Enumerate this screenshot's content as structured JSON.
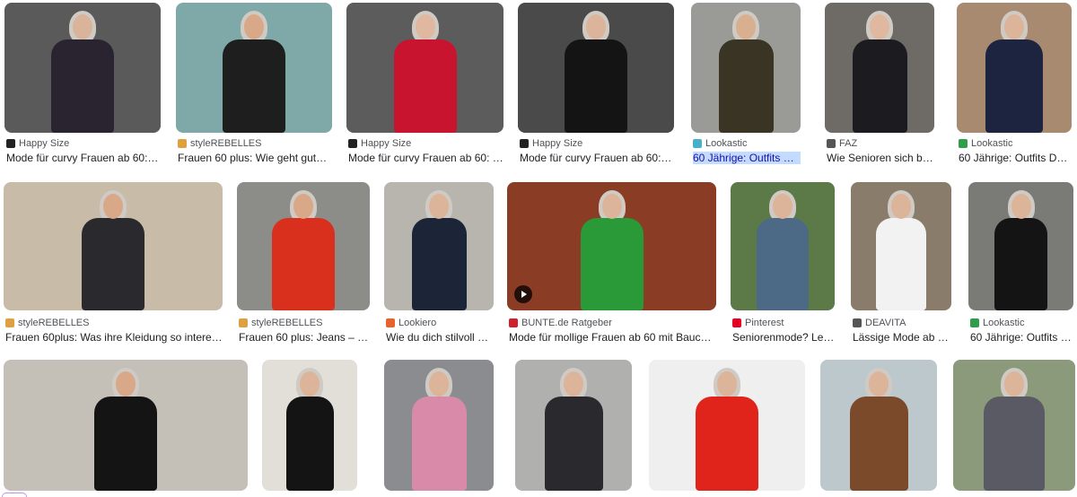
{
  "row1": [
    {
      "source": "Happy Size",
      "title": "Mode für curvy Frauen ab 60: …",
      "fav": "#222222",
      "favGlyph": "H",
      "bg": "#5a5a5a",
      "fg": "#2a2430",
      "skin": "#d9b49a"
    },
    {
      "source": "styleREBELLES",
      "title": "Frauen 60 plus: Wie geht gute…",
      "fav": "#e0a040",
      "favGlyph": "⚓",
      "bg": "#7fa8a8",
      "fg": "#1e1e1e",
      "skin": "#d8a888"
    },
    {
      "source": "Happy Size",
      "title": "Mode für curvy Frauen ab 60: …",
      "fav": "#222222",
      "favGlyph": "H",
      "bg": "#5c5c5c",
      "fg": "#c8142e",
      "skin": "#e0b8a0"
    },
    {
      "source": "Happy Size",
      "title": "Mode für curvy Frauen ab 60: …",
      "fav": "#222222",
      "favGlyph": "H",
      "bg": "#4a4a4a",
      "fg": "#141414",
      "skin": "#dcb49c"
    },
    {
      "source": "Lookastic",
      "title": "60 Jährige: Outfits Da…",
      "fav": "#46b1c9",
      "favGlyph": "L",
      "bg": "#9a9a96",
      "fg": "#3a3424",
      "skin": "#d8b090",
      "selected": true
    },
    {
      "source": "FAZ",
      "title": "Wie Senioren sich be…",
      "fav": "#555555",
      "favGlyph": "F",
      "bg": "#6e6a66",
      "fg": "#1c1c20",
      "skin": "#e0b8a0"
    },
    {
      "source": "Lookastic",
      "title": "60 Jährige: Outfits Da…",
      "fav": "#2e9e4a",
      "favGlyph": "L",
      "bg": "#a88a70",
      "fg": "#1c2440",
      "skin": "#dcb49a"
    }
  ],
  "row2": [
    {
      "source": "styleREBELLES",
      "title": "Frauen 60plus: Was ihre Kleidung so intere…",
      "fav": "#e0a040",
      "favGlyph": "⚓",
      "bg": "#c8bba8",
      "fg": "#2a2a2e",
      "skin": "#d8a888"
    },
    {
      "source": "styleREBELLES",
      "title": "Frauen 60 plus: Jeans – …",
      "fav": "#e0a040",
      "favGlyph": "⚓",
      "bg": "#8c8c88",
      "fg": "#d8301c",
      "skin": "#d8a888"
    },
    {
      "source": "Lookiero",
      "title": "Wie du dich stilvoll …",
      "fav": "#e8622c",
      "favGlyph": "lk",
      "bg": "#b8b4ae",
      "fg": "#1c2438",
      "skin": "#dcb49a"
    },
    {
      "source": "BUNTE.de Ratgeber",
      "title": "Mode für mollige Frauen ab 60 mit Bauch…",
      "fav": "#d0202c",
      "favGlyph": "B",
      "bg": "#8a3c24",
      "fg": "#2a9a38",
      "skin": "#dcb49a",
      "video": true
    },
    {
      "source": "Pinterest",
      "title": "Seniorenmode? Le…",
      "fav": "#e60023",
      "favGlyph": "P",
      "bg": "#5c7a48",
      "fg": "#4c6a86",
      "skin": "#dcb49a"
    },
    {
      "source": "DEAVITA",
      "title": "Lässige Mode ab 6…",
      "fav": "#555555",
      "favGlyph": "D",
      "bg": "#8a7c6a",
      "fg": "#f2f2f2",
      "skin": "#dcb49a"
    },
    {
      "source": "Lookastic",
      "title": "60 Jährige: Outfits …",
      "fav": "#2e9e4a",
      "favGlyph": "L",
      "bg": "#7a7a76",
      "fg": "#141414",
      "skin": "#dcb49a"
    }
  ],
  "row3": [
    {
      "bg": "#c4c0b8",
      "fg": "#141414",
      "skin": "#d8a888"
    },
    {
      "bg": "#e2ded8",
      "fg": "#141414",
      "skin": "#dcb49a"
    },
    {
      "bg": "#8a8c90",
      "fg": "#d88aa8",
      "skin": "#dcb49a"
    },
    {
      "bg": "#b0b0ae",
      "fg": "#2a2a2e",
      "skin": "#dcb49a"
    },
    {
      "bg": "#efefef",
      "fg": "#e0241c",
      "skin": "#dcb49a"
    },
    {
      "bg": "#bcc8cc",
      "fg": "#7a4a2a",
      "skin": "#dcb49a"
    },
    {
      "bg": "#8a9a7a",
      "fg": "#5a5a64",
      "skin": "#dcb49a"
    }
  ]
}
